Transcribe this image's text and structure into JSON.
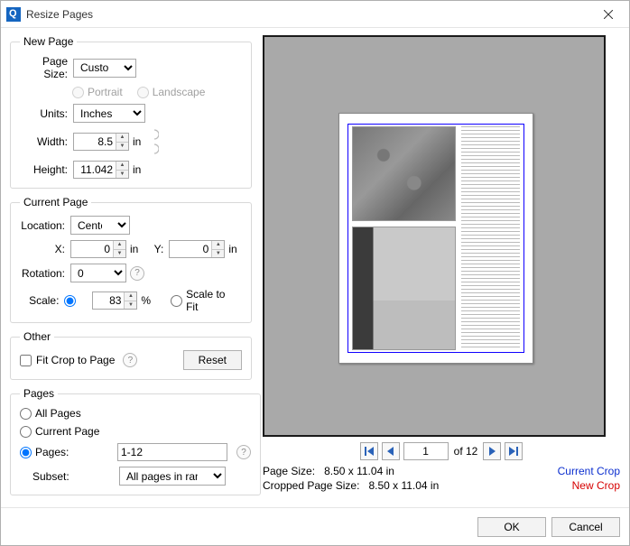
{
  "window": {
    "title": "Resize Pages"
  },
  "groups": {
    "newpage": "New Page",
    "currentpage": "Current Page",
    "other": "Other",
    "pages": "Pages"
  },
  "newpage": {
    "pagesize_label": "Page Size:",
    "pagesize_value": "Custom",
    "orientation": {
      "portrait": "Portrait",
      "landscape": "Landscape"
    },
    "units_label": "Units:",
    "units_value": "Inches",
    "width_label": "Width:",
    "width_value": "8.5",
    "width_unit": "in",
    "height_label": "Height:",
    "height_value": "11.042",
    "height_unit": "in"
  },
  "currentpage": {
    "location_label": "Location:",
    "location_value": "Center",
    "x_label": "X:",
    "x_value": "0",
    "x_unit": "in",
    "y_label": "Y:",
    "y_value": "0",
    "y_unit": "in",
    "rotation_label": "Rotation:",
    "rotation_value": "0",
    "scale_label": "Scale:",
    "scale_value": "83",
    "scale_unit": "%",
    "scale_to_fit": "Scale to Fit"
  },
  "other": {
    "fit_crop": "Fit Crop to Page",
    "reset": "Reset"
  },
  "pages": {
    "all": "All Pages",
    "current": "Current Page",
    "range_label": "Pages:",
    "range_value": "1-12",
    "subset_label": "Subset:",
    "subset_value": "All pages in range"
  },
  "pager": {
    "current": "1",
    "total": "of 12"
  },
  "info": {
    "page_size_label": "Page Size:",
    "page_size_value": "8.50 x 11.04 in",
    "cropped_label": "Cropped Page Size:",
    "cropped_value": "8.50 x 11.04 in",
    "current_crop": "Current Crop",
    "new_crop": "New Crop"
  },
  "footer": {
    "ok": "OK",
    "cancel": "Cancel"
  }
}
